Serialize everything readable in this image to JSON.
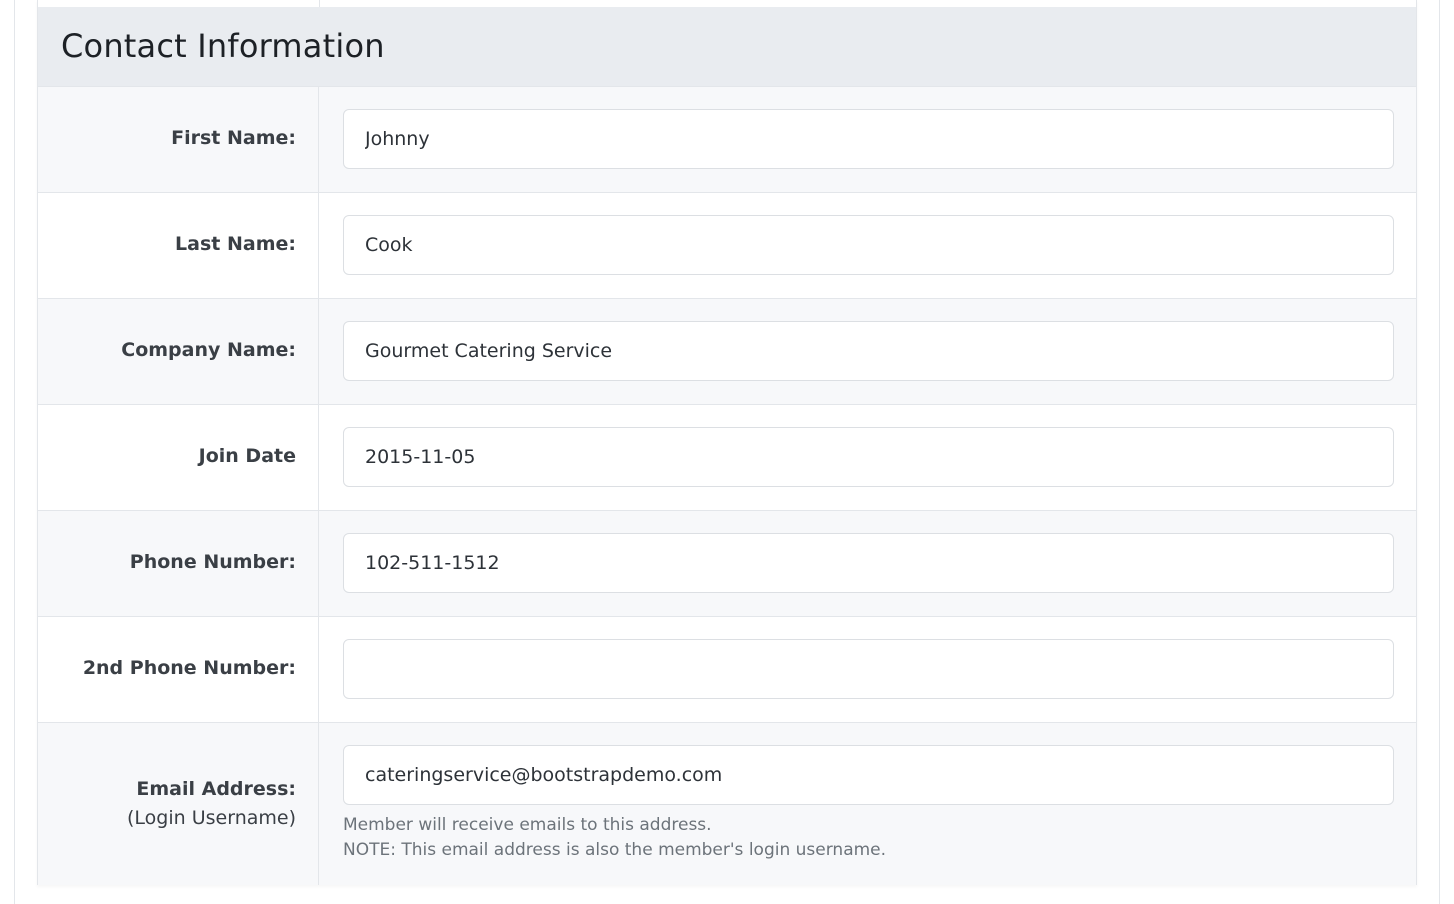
{
  "section": {
    "title": "Contact Information"
  },
  "fields": {
    "first_name": {
      "label": "First Name:",
      "value": "Johnny"
    },
    "last_name": {
      "label": "Last Name:",
      "value": "Cook"
    },
    "company_name": {
      "label": "Company Name:",
      "value": "Gourmet Catering Service"
    },
    "join_date": {
      "label": "Join Date",
      "value": "2015-11-05"
    },
    "phone": {
      "label": "Phone Number:",
      "value": "102-511-1512"
    },
    "phone2": {
      "label": "2nd Phone Number:",
      "value": ""
    },
    "email": {
      "label": "Email Address:",
      "sublabel": "(Login Username)",
      "value": "cateringservice@bootstrapdemo.com",
      "help_line1": "Member will receive emails to this address.",
      "help_line2": "NOTE: This email address is also the member's login username."
    }
  }
}
